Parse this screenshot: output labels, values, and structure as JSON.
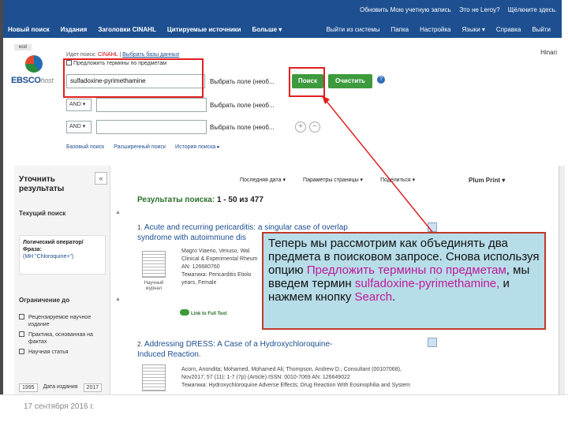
{
  "topnav": {
    "top_links": [
      "Обновить Мою учетную запись",
      "Это не Leroy?",
      "Щёлкните здесь."
    ],
    "menu": [
      "Новый поиск",
      "Издания",
      "Заголовки CINAHL",
      "Цитируемые источники",
      "Больше ▾"
    ],
    "menu_right": [
      "Выйти из системы",
      "Папка",
      "Настройка",
      "Языки ▾",
      "Справка",
      "Выйти"
    ]
  },
  "search": {
    "my_label": "мой",
    "logo": "EBSCO",
    "logo_suffix": "host",
    "db_prefix": "Идет поиск:",
    "db_name": "CINAHL",
    "db_choose": "Выбрать базы данных",
    "suggest_label": "Предложить термины по предметам",
    "query_value": "sulfadoxine-pyrimethamine",
    "field_select": "Выбрать поле (необ...",
    "bool1": "AND ▾",
    "bool2": "AND ▾",
    "search_button": "Поиск",
    "clear_button": "Очистить",
    "help": "?",
    "plus": "+",
    "minus": "−",
    "links": [
      "Базовый поиск",
      "Расширенный поиск",
      "История поиска ▸"
    ],
    "hinari": "Hinari"
  },
  "left": {
    "title": "Уточнить результаты",
    "collapse": "«",
    "current_search": "Текущий поиск",
    "logic_label": "Логический оператор/Фраза:",
    "logic_value": "(MH \"Chloroquine+\")",
    "limit_to": "Ограничение до",
    "limits": [
      "Рецензируемое научное издание",
      "Практика, основанная на фактах",
      "Научная статья"
    ],
    "years": [
      "1995",
      "Дата издания",
      "2017"
    ]
  },
  "results": {
    "header": "Результаты поиска:",
    "range": "1 - 50 из 477",
    "toolbar": [
      "Последняя дата ▾",
      "Параметры страницы ▾",
      "Поделиться ▾"
    ],
    "plum_print": "Plum Print ▾",
    "items": [
      {
        "num": "1.",
        "title1": "Acute and recurring pericarditis: a singular case of overlap",
        "title2": "syndrome with autoimmune dis",
        "doctype": "Научный журнал",
        "meta1": "Magro Viaerio, Venuso, Wal",
        "meta2": "Clinical & Experimental Rheum",
        "meta3": "AN: 126680760",
        "meta4": "Тематика: Pericarditis Etiolo",
        "meta5": "years, Female",
        "fulltext": "Link to Full Text"
      },
      {
        "num": "2.",
        "title1": "Addressing DRESS: A Case of a Hydroxychloroquine-",
        "title2": "Induced Reaction.",
        "meta1": "Acorn, Anondita; Mohamed, Mohamed Ali; Thompson, Andrew D.; Consultant (00107068),",
        "meta2": "Nov2017; 57 (11): 1-7 (7p) (Article) ISSN: 0010-7069 AN: 126649022",
        "meta3": "Тематика: Hydroxychloroquine Adverse Effects; Drug Reaction With Eosinophilia and System"
      }
    ]
  },
  "callout": {
    "line1": "Теперь мы рассмотрим как объединять два предмета в поисковом запросе. Снова используя опцию ",
    "hl1": "Предложить термины по предметам",
    "line2": ", мы введем термин ",
    "hl2": "sulfadoxine-pyrimethamine,",
    "line3": "  и нажмем кнопку ",
    "hl3": "Search",
    "line4": "."
  },
  "footer": {
    "date": "17 сентября 2016 г."
  },
  "colors": {
    "nav": "#1d4f91",
    "green": "#3d9a3d",
    "callout_bg": "#b7dde8",
    "highlight": "#c0189b",
    "red": "#e02020"
  }
}
